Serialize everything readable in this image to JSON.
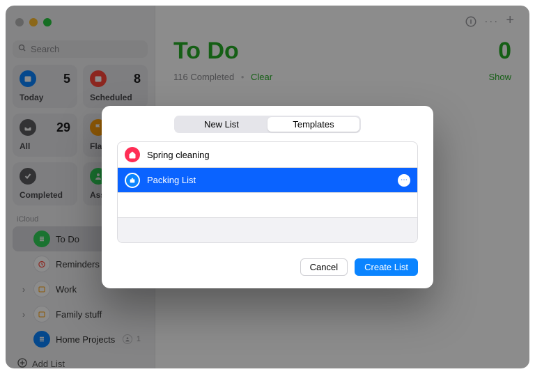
{
  "search": {
    "placeholder": "Search"
  },
  "tiles": [
    {
      "label": "Today",
      "count": "5",
      "color": "#0a84ff"
    },
    {
      "label": "Scheduled",
      "count": "8",
      "color": "#ff453a"
    },
    {
      "label": "All",
      "count": "29",
      "color": "#5b5b60"
    },
    {
      "label": "Flagged",
      "count": "",
      "color": "#ff9f0a"
    },
    {
      "label": "Completed",
      "count": "",
      "color": "#5b5b60"
    },
    {
      "label": "Assigned",
      "count": "",
      "color": "#30d158"
    }
  ],
  "sidebar_section": "iCloud",
  "lists": [
    {
      "name": "To Do",
      "color": "#30d158",
      "selected": true,
      "chev": ""
    },
    {
      "name": "Reminders",
      "color": "#ff453a",
      "chev": ""
    },
    {
      "name": "Work",
      "color": "#ff9f0a",
      "chev": "›"
    },
    {
      "name": "Family stuff",
      "color": "#ff9f0a",
      "chev": "›"
    },
    {
      "name": "Home Projects",
      "color": "#0a84ff",
      "chev": "",
      "shared": true,
      "badge": "1"
    }
  ],
  "add_list_label": "Add List",
  "main": {
    "title": "To Do",
    "count": "0",
    "completed_text": "116 Completed",
    "clear_label": "Clear",
    "show_label": "Show"
  },
  "sheet": {
    "tabs": {
      "new_list": "New List",
      "templates": "Templates"
    },
    "active_tab": "templates",
    "templates": [
      {
        "name": "Spring cleaning",
        "color": "#ff2d55",
        "selected": false
      },
      {
        "name": "Packing List",
        "color": "#0a84ff",
        "selected": true
      }
    ],
    "cancel": "Cancel",
    "create": "Create List"
  }
}
